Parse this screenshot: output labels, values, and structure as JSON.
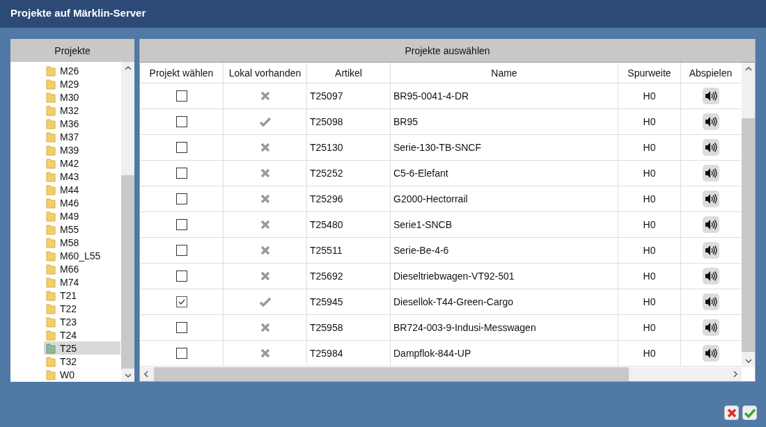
{
  "window": {
    "title": "Projekte auf Märklin-Server"
  },
  "tree": {
    "header": "Projekte",
    "items": [
      {
        "label": "M26",
        "selected": false
      },
      {
        "label": "M29",
        "selected": false
      },
      {
        "label": "M30",
        "selected": false
      },
      {
        "label": "M32",
        "selected": false
      },
      {
        "label": "M36",
        "selected": false
      },
      {
        "label": "M37",
        "selected": false
      },
      {
        "label": "M39",
        "selected": false
      },
      {
        "label": "M42",
        "selected": false
      },
      {
        "label": "M43",
        "selected": false
      },
      {
        "label": "M44",
        "selected": false
      },
      {
        "label": "M46",
        "selected": false
      },
      {
        "label": "M49",
        "selected": false
      },
      {
        "label": "M55",
        "selected": false
      },
      {
        "label": "M58",
        "selected": false
      },
      {
        "label": "M60_L55",
        "selected": false
      },
      {
        "label": "M66",
        "selected": false
      },
      {
        "label": "M74",
        "selected": false
      },
      {
        "label": "T21",
        "selected": false
      },
      {
        "label": "T22",
        "selected": false
      },
      {
        "label": "T23",
        "selected": false
      },
      {
        "label": "T24",
        "selected": false
      },
      {
        "label": "T25",
        "selected": true
      },
      {
        "label": "T32",
        "selected": false
      },
      {
        "label": "W0",
        "selected": false
      }
    ]
  },
  "table": {
    "header": "Projekte auswählen",
    "columns": [
      "Projekt wählen",
      "Lokal vorhanden",
      "Artikel",
      "Name",
      "Spurweite",
      "Abspielen"
    ],
    "rows": [
      {
        "checked": false,
        "local": false,
        "article": "T25097",
        "name": "BR95-0041-4-DR",
        "gauge": "H0"
      },
      {
        "checked": false,
        "local": true,
        "article": "T25098",
        "name": "BR95",
        "gauge": "H0"
      },
      {
        "checked": false,
        "local": false,
        "article": "T25130",
        "name": "Serie-130-TB-SNCF",
        "gauge": "H0"
      },
      {
        "checked": false,
        "local": false,
        "article": "T25252",
        "name": "C5-6-Elefant",
        "gauge": "H0"
      },
      {
        "checked": false,
        "local": false,
        "article": "T25296",
        "name": "G2000-Hectorrail",
        "gauge": "H0"
      },
      {
        "checked": false,
        "local": false,
        "article": "T25480",
        "name": "Serie1-SNCB",
        "gauge": "H0"
      },
      {
        "checked": false,
        "local": false,
        "article": "T25511",
        "name": "Serie-Be-4-6",
        "gauge": "H0"
      },
      {
        "checked": false,
        "local": false,
        "article": "T25692",
        "name": "Dieseltriebwagen-VT92-501",
        "gauge": "H0"
      },
      {
        "checked": true,
        "local": true,
        "article": "T25945",
        "name": "Diesellok-T44-Green-Cargo",
        "gauge": "H0"
      },
      {
        "checked": false,
        "local": false,
        "article": "T25958",
        "name": "BR724-003-9-Indusi-Messwagen",
        "gauge": "H0"
      },
      {
        "checked": false,
        "local": false,
        "article": "T25984",
        "name": "Dampflok-844-UP",
        "gauge": "H0"
      }
    ]
  }
}
